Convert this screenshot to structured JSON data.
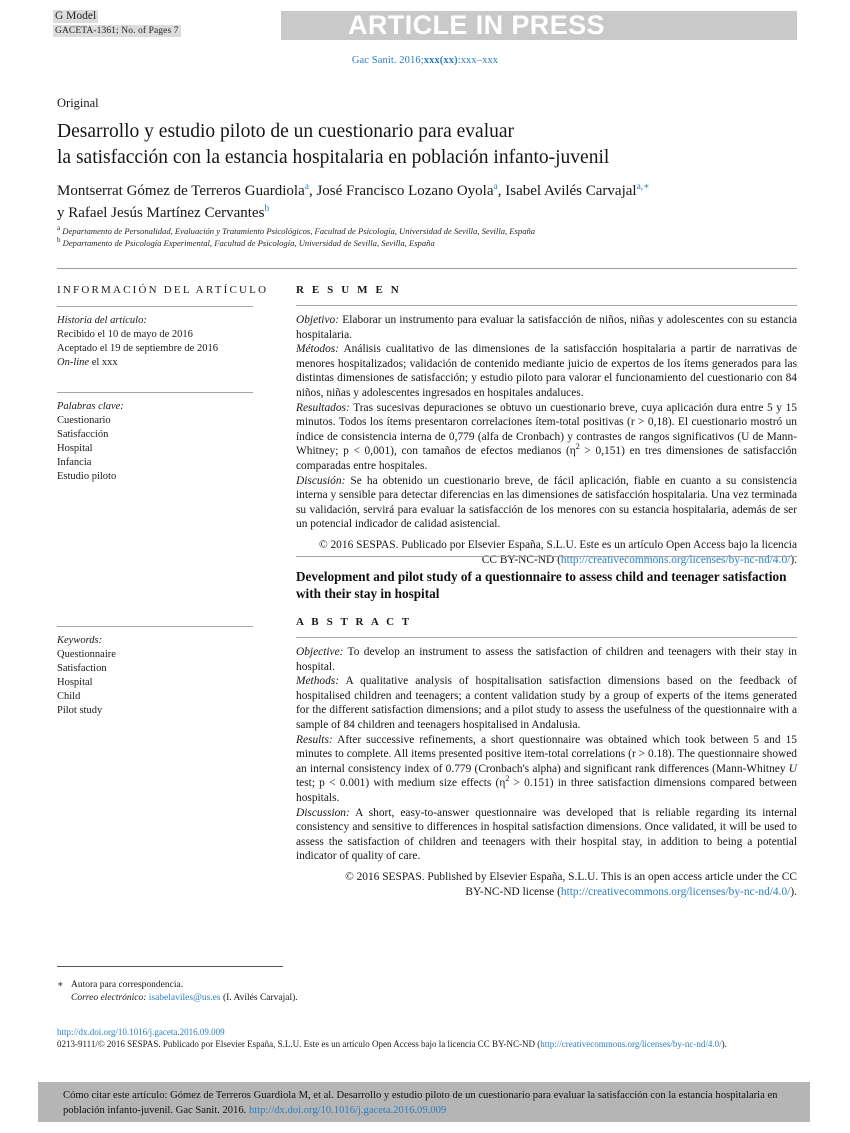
{
  "banner": {
    "g_model": "G Model",
    "g_model_sub": "GACETA-1361;   No. of Pages 7",
    "article_in_press": "ARTICLE IN PRESS",
    "journal_ref_prefix": "Gac Sanit. 2016;",
    "journal_ref_bold": "xxx(xx)",
    "journal_ref_suffix": ":xxx–xxx",
    "banner_bg": "#c9c9c9",
    "link_color": "#2b7fc0"
  },
  "article": {
    "type": "Original",
    "title_line1": "Desarrollo y estudio piloto de un cuestionario para evaluar",
    "title_line2": "la satisfacción con la estancia hospitalaria en población infanto-juvenil",
    "authors_html": "Montserrat Gómez de Terreros Guardiola<sup>a</sup>,  José Francisco Lozano Oyola<sup>a</sup>,  Isabel Avilés Carvajal<sup>a,∗</sup><br>y Rafael Jesús Martínez Cervantes<sup>b</sup>",
    "affiliation_a": "Departamento de Personalidad, Evaluación y Tratamiento Psicológicos, Facultad de Psicología, Universidad de Sevilla, Sevilla, España",
    "affiliation_b": "Departamento de Psicología Experimental, Facultad de Psicología, Universidad de Sevilla, Sevilla, España"
  },
  "info_panel": {
    "heading": "INFORMACIÓN DEL ARTÍCULO",
    "history_label": "Historia del artículo:",
    "history": [
      "Recibido el 10 de mayo de 2016",
      "Aceptado el 19 de septiembre de 2016"
    ],
    "online_italic": "On-line",
    "online_rest": " el xxx",
    "keywords_label": "Palabras clave:",
    "keywords": [
      "Cuestionario",
      "Satisfacción",
      "Hospital",
      "Infancia",
      "Estudio piloto"
    ]
  },
  "info_panel_en": {
    "keywords_label": "Keywords:",
    "keywords": [
      "Questionnaire",
      "Satisfaction",
      "Hospital",
      "Child",
      "Pilot study"
    ]
  },
  "resumen": {
    "heading": "R E S U M E N",
    "objetivo_label": "Objetivo:",
    "objetivo_text": " Elaborar un instrumento para evaluar la satisfacción de niños, niñas y adolescentes con su estancia hospitalaria.",
    "metodos_label": "Métodos:",
    "metodos_text": " Análisis cualitativo de las dimensiones de la satisfacción hospitalaria a partir de narrativas de menores hospitalizados; validación de contenido mediante juicio de expertos de los ítems generados para las distintas dimensiones de satisfacción; y estudio piloto para valorar el funcionamiento del cuestionario con 84 niños, niñas y adolescentes ingresados en hospitales andaluces.",
    "resultados_label": "Resultados:",
    "resultados_text_1": " Tras sucesivas depuraciones se obtuvo un cuestionario breve, cuya aplicación dura entre 5 y 15 minutos. Todos los ítems presentaron correlaciones ítem-total positivas (r > 0,18). El cuestionario mostró un índice de consistencia interna de 0,779 (alfa de Cronbach) y contrastes de rangos significativos (U de Mann-Whitney; p < 0,001), con tamaños de efectos medianos (η",
    "resultados_sup": "2",
    "resultados_text_2": " > 0,151) en tres dimensiones de satisfacción comparadas entre hospitales.",
    "discusion_label": "Discusión:",
    "discusion_text": " Se ha obtenido un cuestionario breve, de fácil aplicación, fiable en cuanto a su consistencia interna y sensible para detectar diferencias en las dimensiones de satisfacción hospitalaria. Una vez terminada su validación, servirá para evaluar la satisfacción de los menores con su estancia hospitalaria, además de ser un potencial indicador de calidad asistencial.",
    "copyright_line1": "© 2016 SESPAS. Publicado por Elsevier España, S.L.U. Este es un artículo Open Access bajo la licencia",
    "copyright_line2_pre": "CC BY-NC-ND (",
    "copyright_link": "http://creativecommons.org/licenses/by-nc-nd/4.0/",
    "copyright_line2_post": ")."
  },
  "abstract": {
    "en_title": "Development and pilot study of a questionnaire to assess child and teenager satisfaction with their stay in hospital",
    "heading": "A B S T R A C T",
    "objective_label": "Objective:",
    "objective_text": " To develop an instrument to assess the satisfaction of children and teenagers with their stay in hospital.",
    "methods_label": "Methods:",
    "methods_text": " A qualitative analysis of hospitalisation satisfaction dimensions based on the feedback of hospitalised children and teenagers; a content validation study by a group of experts of the items generated for the different satisfaction dimensions; and a pilot study to assess the usefulness of the questionnaire with a sample of 84 children and teenagers hospitalised in Andalusia.",
    "results_label": "Results:",
    "results_text_1": " After successive refinements, a short questionnaire was obtained which took between 5 and 15 minutes to complete. All items presented positive item-total correlations (r > 0.18). The questionnaire showed an internal consistency index of 0.779 (Cronbach's alpha) and significant rank differences (Mann-Whitney ",
    "results_italic": "U",
    "results_text_2": " test; p < 0.001) with medium size effects (η",
    "results_sup": "2",
    "results_text_3": " > 0.151) in three satisfaction dimensions compared between hospitals.",
    "discussion_label": "Discussion:",
    "discussion_text": " A short, easy-to-answer questionnaire was developed that is reliable regarding its internal consistency and sensitive to differences in hospital satisfaction dimensions. Once validated, it will be used to assess the satisfaction of children and teenagers with their hospital stay, in addition to being a potential indicator of quality of care.",
    "copyright_line1": "© 2016 SESPAS. Published by Elsevier España, S.L.U. This is an open access article under the CC",
    "copyright_line2_pre": "BY-NC-ND license (",
    "copyright_link": "http://creativecommons.org/licenses/by-nc-nd/4.0/",
    "copyright_line2_post": ")."
  },
  "footnotes": {
    "star": "∗",
    "correspondence": "Autora para correspondencia.",
    "email_label": "Correo electrónico:",
    "email": "isabelaviles@us.es",
    "email_person": " (I. Avilés Carvajal)."
  },
  "doi_block": {
    "doi_url": "http://dx.doi.org/10.1016/j.gaceta.2016.09.009",
    "issn_text": "0213-9111/© 2016 SESPAS. Publicado por Elsevier España, S.L.U. Este es un artículo Open Access bajo la licencia CC BY-NC-ND (",
    "license_link": "http://creativecommons.org/licenses/by-nc-nd/4.0/",
    "issn_text_end": ")."
  },
  "cite_box": {
    "text_pre": "Cómo citar este artículo: Gómez de Terreros Guardiola M, et al. Desarrollo y estudio piloto de un cuestionario para evaluar la satisfacción con la estancia hospitalaria en población infanto-juvenil. Gac Sanit. 2016. ",
    "link": "http://dx.doi.org/10.1016/j.gaceta.2016.09.009",
    "bg_color": "#b5b5b5"
  }
}
